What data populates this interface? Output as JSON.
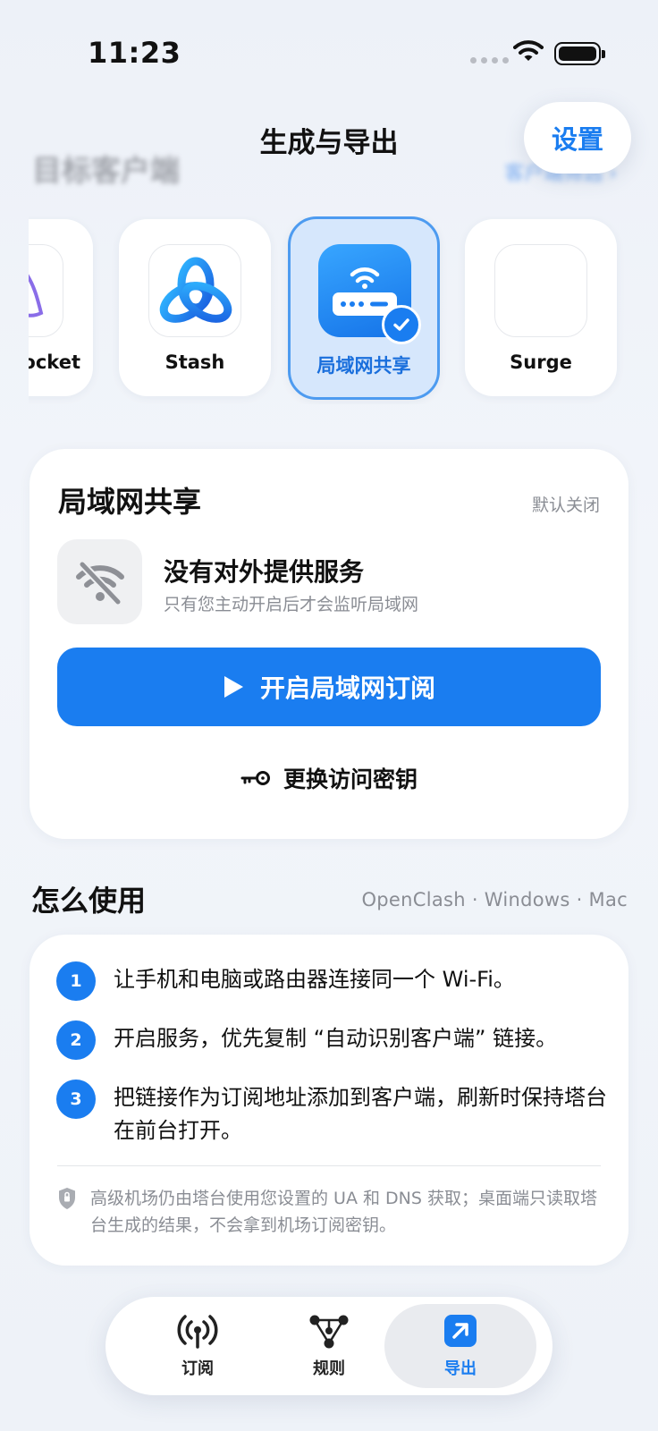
{
  "status_bar": {
    "time": "11:23"
  },
  "header": {
    "title": "生成与导出",
    "settings_label": "设置",
    "blurred_section_title": "目标客户端",
    "blurred_link": "客户端筛选 ›"
  },
  "clients": [
    {
      "name": "rocket",
      "icon": "shadowrocket-icon",
      "selected": false
    },
    {
      "name": "Stash",
      "icon": "stash-icon",
      "selected": false
    },
    {
      "name": "局域网共享",
      "icon": "router-wifi-icon",
      "selected": true
    },
    {
      "name": "Surge",
      "icon": "surge-icon",
      "selected": false
    }
  ],
  "lan_card": {
    "title": "局域网共享",
    "default_state": "默认关闭",
    "status_title": "没有对外提供服务",
    "status_subtitle": "只有您主动开启后才会监听局域网",
    "start_button": "开启局域网订阅",
    "change_key_button": "更换访问密钥"
  },
  "usage": {
    "title": "怎么使用",
    "platforms": "OpenClash · Windows · Mac",
    "steps": [
      {
        "num": "1",
        "text": "让手机和电脑或路由器连接同一个 Wi-Fi。"
      },
      {
        "num": "2",
        "text": "开启服务，优先复制 “自动识别客户端” 链接。"
      },
      {
        "num": "3",
        "text": "把链接作为订阅地址添加到客户端，刷新时保持塔台在前台打开。"
      }
    ],
    "note": "高级机场仍由塔台使用您设置的 UA 和 DNS 获取；桌面端只读取塔台生成的结果，不会拿到机场订阅密钥。"
  },
  "tabs": [
    {
      "label": "订阅",
      "icon": "antenna-icon",
      "active": false
    },
    {
      "label": "规则",
      "icon": "rules-graph-icon",
      "active": false
    },
    {
      "label": "导出",
      "icon": "export-arrow-icon",
      "active": true
    }
  ],
  "colors": {
    "accent": "#1a7df0",
    "selected_bg": "#d6e7fc",
    "muted_text": "#8a8d94"
  }
}
